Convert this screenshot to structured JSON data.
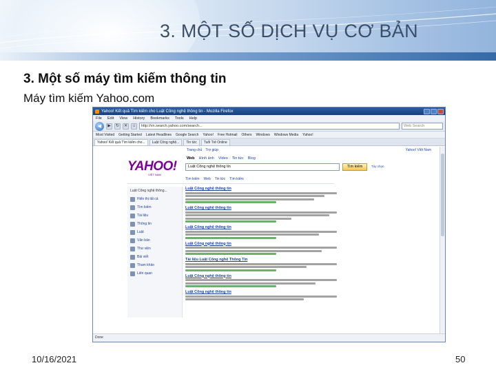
{
  "slide": {
    "title": "3. MỘT SỐ DỊCH VỤ CƠ BẢN",
    "heading": "3. Một số máy tìm kiếm thông tin",
    "subheading": "Máy tìm kiếm Yahoo.com",
    "date": "10/16/2021",
    "page_number": "50"
  },
  "browser": {
    "window_title": "Yahoo! Kết quả Tìm kiếm cho Luật Công nghệ thông tin - Mozilla Firefox",
    "menu": [
      "File",
      "Edit",
      "View",
      "History",
      "Bookmarks",
      "Tools",
      "Help"
    ],
    "url": "http://vn.search.yahoo.com/search...",
    "search_placeholder": "Web Search",
    "bookmarks": [
      "Most Visited",
      "Getting Started",
      "Latest Headlines",
      "Google Search",
      "Yahoo!",
      "Free Hotmail",
      "Others",
      "Windows",
      "Windows Media",
      "Yahoo!"
    ],
    "tabs": [
      "Yahoo! Kết quả Tìm kiếm cho...",
      "Luật Công nghệ...",
      "Tin tức",
      "Tuổi Trẻ Online"
    ],
    "status": "Done"
  },
  "yahoo": {
    "logo": "YAHOO!",
    "logo_sub": "VIỆT NAM",
    "top_links": [
      "Trang chủ",
      "Trợ giúp"
    ],
    "top_right": "Yahoo! Việt Nam",
    "tabs": [
      "Web",
      "Hình ảnh",
      "Video",
      "Tin tức",
      "Blog"
    ],
    "active_tab": "Web",
    "query": "Luật Công nghệ thông tin",
    "search_button": "Tìm kiếm",
    "options_link": "Tùy chọn",
    "filters": [
      "Tìm kiếm",
      "Web",
      "Tin tức",
      "Tìm kiếm"
    ],
    "left_head": "Luật Công nghệ thông...",
    "left_items": [
      "Hiển thị tất cả",
      "Tìm kiếm",
      "Tài liệu",
      "Thông tin",
      "Luật",
      "Văn bản",
      "Thư viện",
      "Bài viết",
      "Tham khảo",
      "Liên quan"
    ],
    "results": [
      "Luật Công nghệ thông tin",
      "Luật Công nghệ thông tin",
      "Luật Công nghệ thông tin",
      "Luật Công nghệ thông tin",
      "Tài liệu Luật Công nghệ Thông Tin",
      "Luật Công nghệ thông tin",
      "Luật Công nghệ thông tin"
    ]
  }
}
